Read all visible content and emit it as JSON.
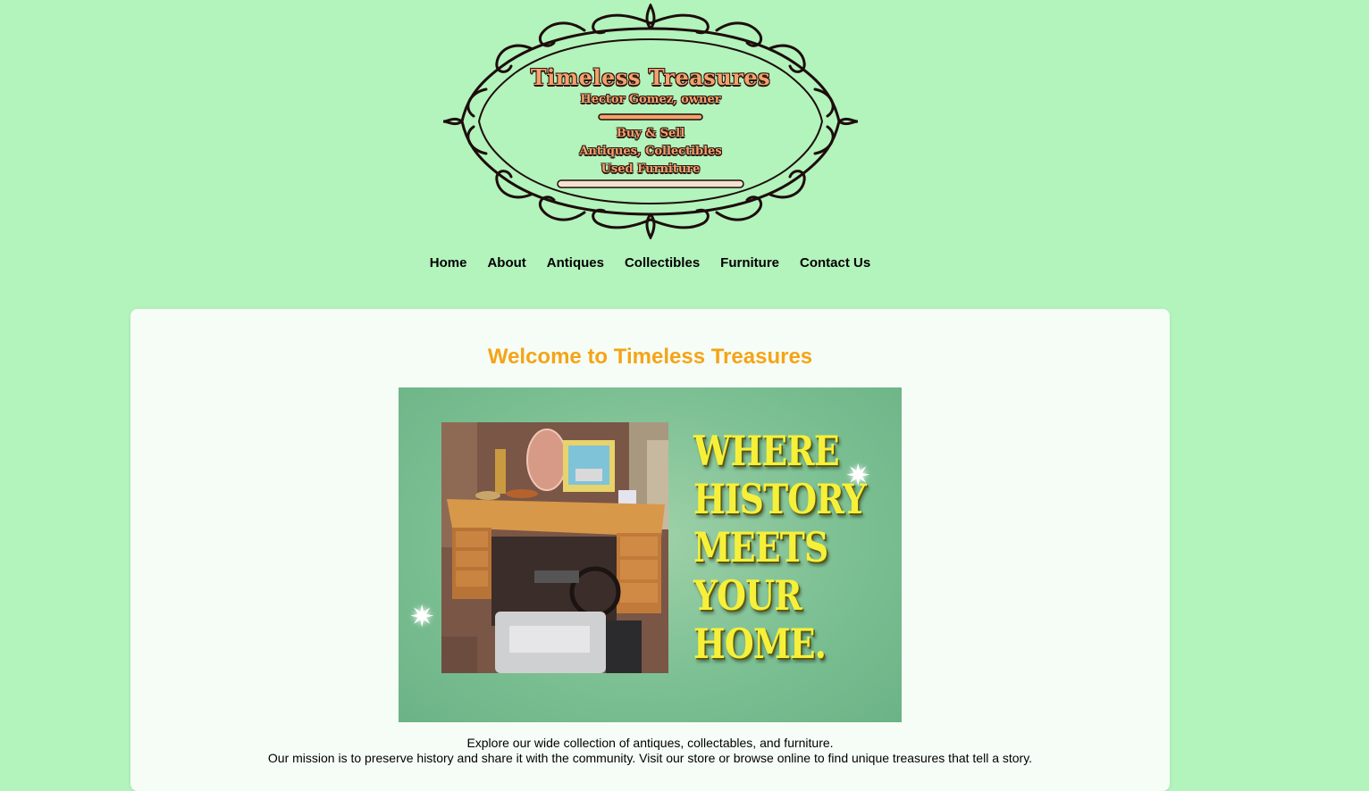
{
  "logo": {
    "title": "Timeless Treasures",
    "owner": "Hector Gomez, owner",
    "buy_sell": "Buy & Sell",
    "antiques_collectibles": "Antiques, Collectibles",
    "used_furniture": "Used Furniture"
  },
  "nav": {
    "items": [
      {
        "label": "Home"
      },
      {
        "label": "About"
      },
      {
        "label": "Antiques"
      },
      {
        "label": "Collectibles"
      },
      {
        "label": "Furniture"
      },
      {
        "label": "Contact Us"
      }
    ]
  },
  "main": {
    "heading": "Welcome to Timeless Treasures",
    "hero": {
      "slogan_line1": "WHERE",
      "slogan_line2": "HISTORY",
      "slogan_line3": "MEETS",
      "slogan_line4": "YOUR",
      "slogan_line5": "HOME."
    },
    "intro_line1": "Explore our wide collection of antiques, collectables, and furniture.",
    "intro_line2": "Our mission is to preserve history and share it with the community. Visit our store or browse online to find unique treasures that tell a story."
  },
  "colors": {
    "page_background": "#b3f3bc",
    "card_background": "#f6fdf6",
    "heading": "#f5a416",
    "slogan": "#f7f03a",
    "logo_text": "#f4a26b"
  }
}
